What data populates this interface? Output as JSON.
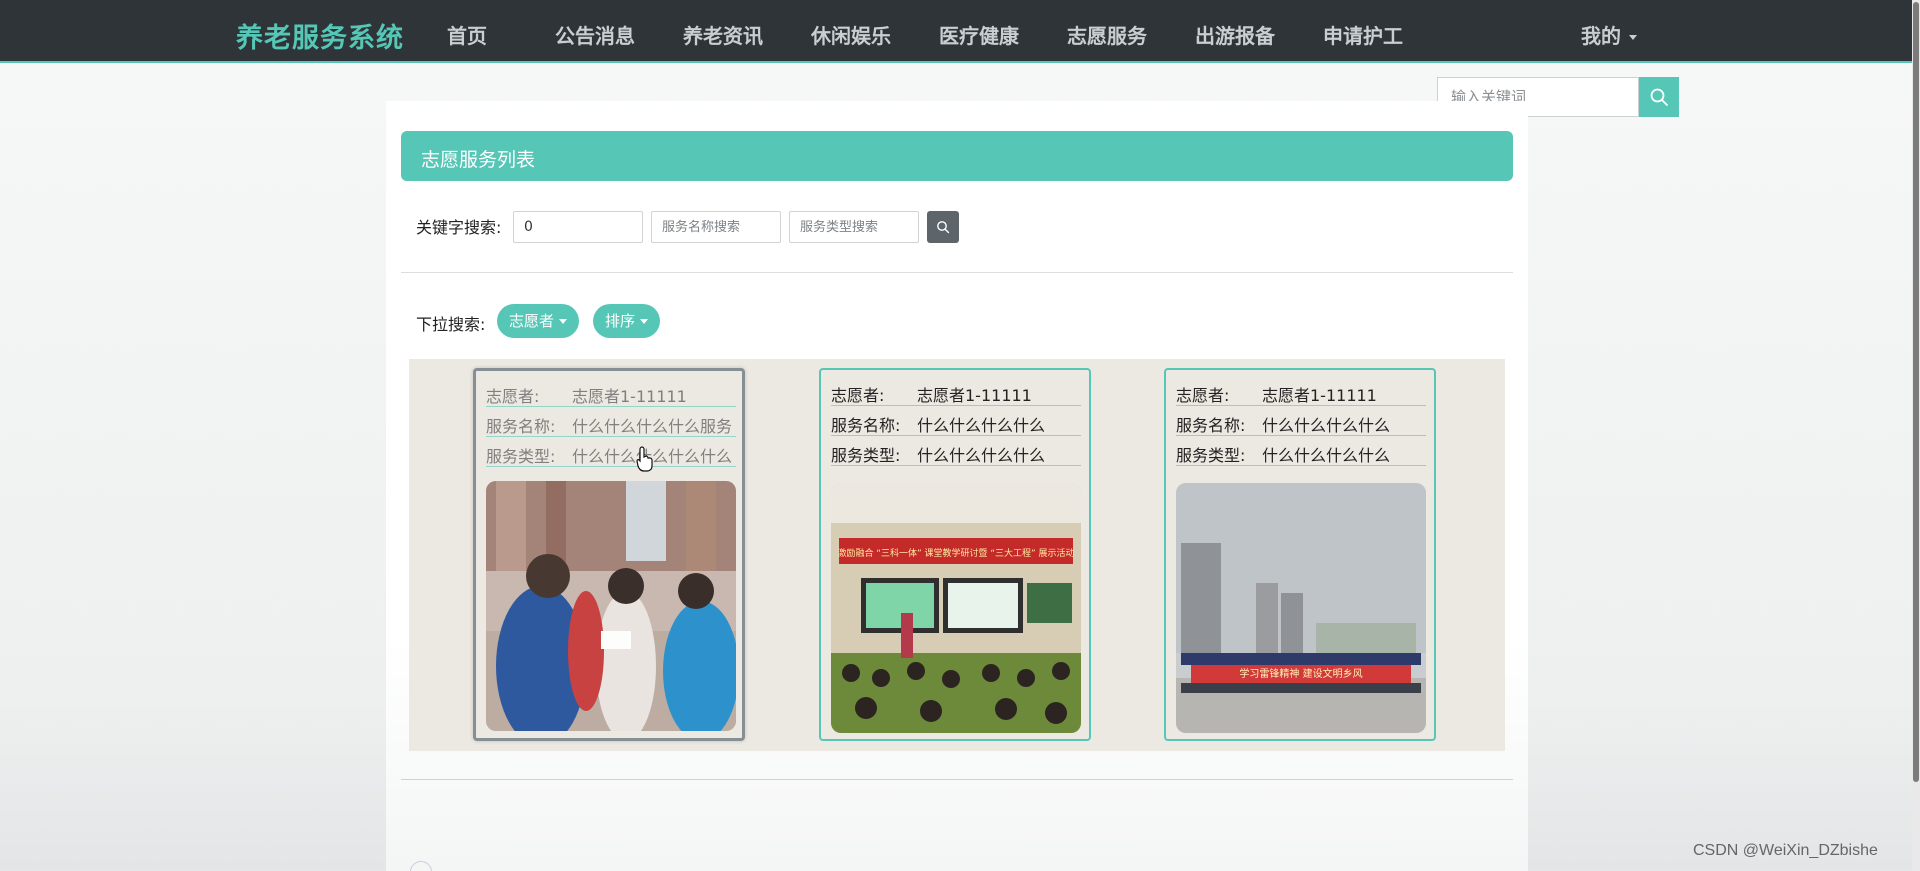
{
  "nav": {
    "brand": "养老服务系统",
    "items": [
      "首页",
      "公告消息",
      "养老资讯",
      "休闲娱乐",
      "医疗健康",
      "志愿服务",
      "出游报备",
      "申请护工"
    ],
    "user_menu": "我的"
  },
  "top_search": {
    "placeholder": "输入关键词",
    "icon": "search-icon"
  },
  "list": {
    "title": "志愿服务列表",
    "keyword_label": "关键字搜索:",
    "inputs": [
      {
        "value": "0",
        "placeholder": ""
      },
      {
        "value": "",
        "placeholder": "服务名称搜索"
      },
      {
        "value": "",
        "placeholder": "服务类型搜索"
      }
    ],
    "dropdown_label": "下拉搜索:",
    "dropdowns": [
      "志愿者",
      "排序"
    ]
  },
  "cards": [
    {
      "labels": [
        "志愿者:",
        "服务名称:",
        "服务类型:"
      ],
      "values": [
        "志愿者1-11111",
        "什么什么什么什么服务",
        "什么什么什么什么什么"
      ]
    },
    {
      "labels": [
        "志愿者:",
        "服务名称:",
        "服务类型:"
      ],
      "values": [
        "志愿者1-11111",
        "什么什么什么什么",
        "什么什么什么什么"
      ]
    },
    {
      "labels": [
        "志愿者:",
        "服务名称:",
        "服务类型:"
      ],
      "values": [
        "志愿者1-11111",
        "什么什么什么什么",
        "什么什么什么什么"
      ]
    }
  ],
  "photo_banners": [
    "激励融合 “三科一体” 课堂教学研讨暨 “三大工程” 展示活动",
    "学习雷锋精神 建设文明乡风"
  ],
  "watermark": "CSDN @WeiXin_DZbishe",
  "colors": {
    "accent": "#56c6b6",
    "navbar": "#2e3437",
    "card_area": "#ece9e2"
  }
}
